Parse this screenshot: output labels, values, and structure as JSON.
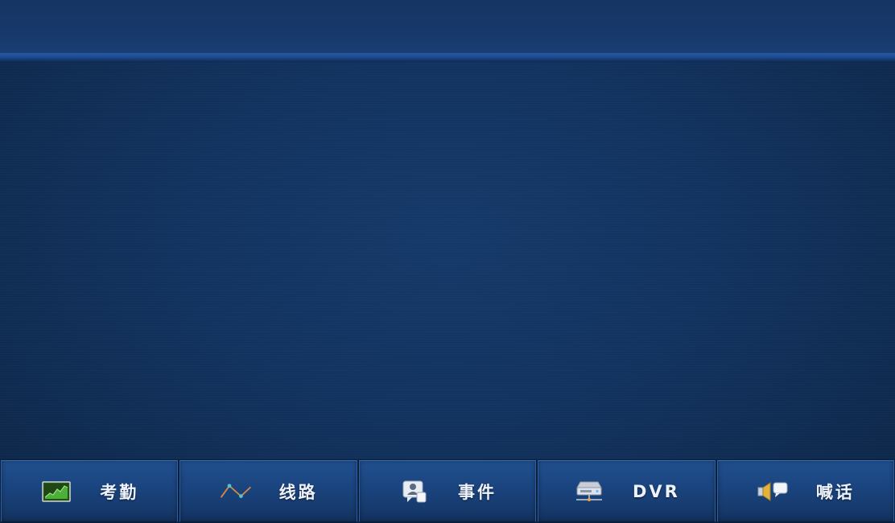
{
  "bottom_nav": {
    "items": [
      {
        "label": "考勤",
        "icon": "attendance-chart-icon"
      },
      {
        "label": "线路",
        "icon": "route-line-icon"
      },
      {
        "label": "事件",
        "icon": "event-message-icon"
      },
      {
        "label": "DVR",
        "icon": "dvr-device-icon"
      },
      {
        "label": "喊话",
        "icon": "speaker-talk-icon"
      }
    ]
  },
  "colors": {
    "background": "#11325f",
    "top_bar": "#17396b",
    "button": "#1b4580",
    "label": "#eef3fb"
  }
}
